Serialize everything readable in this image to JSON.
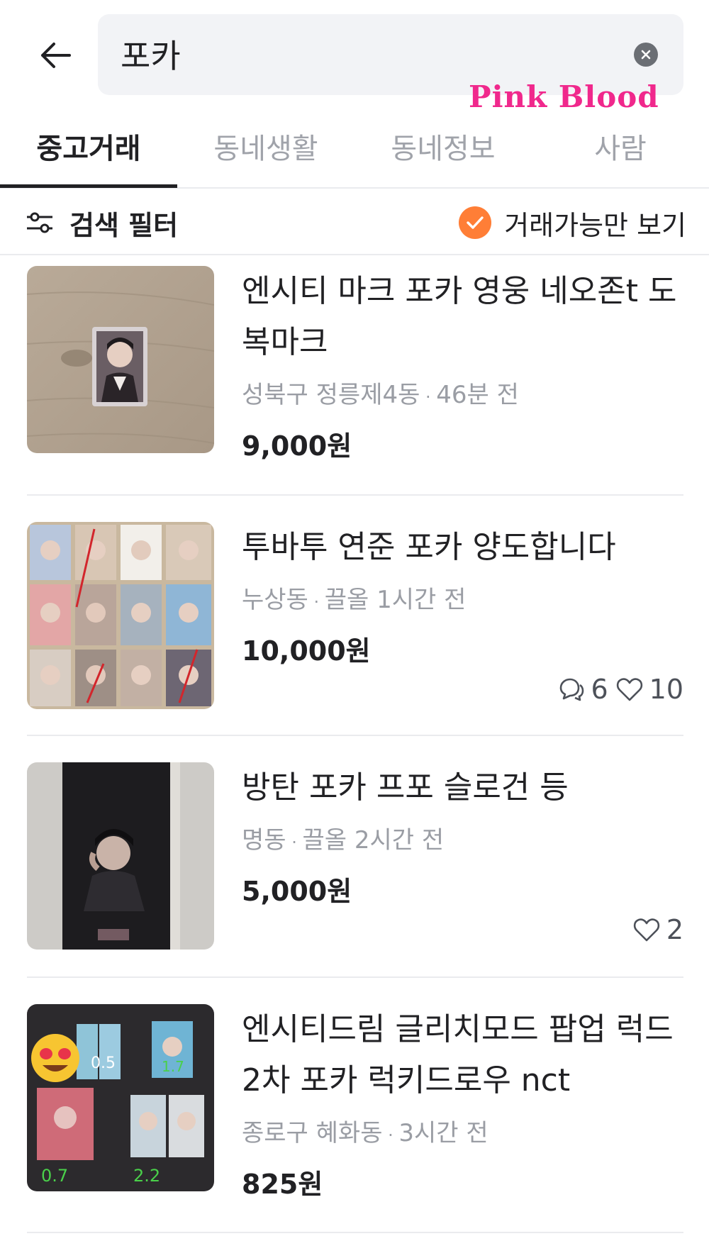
{
  "search": {
    "query": "포카"
  },
  "watermark": "Pink Blood",
  "tabs": [
    {
      "label": "중고거래",
      "active": true
    },
    {
      "label": "동네생활",
      "active": false
    },
    {
      "label": "동네정보",
      "active": false
    },
    {
      "label": "사람",
      "active": false
    }
  ],
  "filter": {
    "label": "검색 필터",
    "available_only_label": "거래가능만 보기",
    "available_only_checked": true
  },
  "colors": {
    "accent": "#ff7e36",
    "watermark": "#f0288c"
  },
  "listings": [
    {
      "title": "엔시티 마크 포카 영웅 네오존t 도복마크",
      "location": "성북구 정릉제4동",
      "time": "46분 전",
      "price": "9,000원",
      "chats": null,
      "likes": null
    },
    {
      "title": "투바투 연준 포카 양도합니다",
      "location": "누상동",
      "time": "끌올 1시간 전",
      "price": "10,000원",
      "chats": "6",
      "likes": "10"
    },
    {
      "title": "방탄 포카 프포 슬로건 등",
      "location": "명동",
      "time": "끌올 2시간 전",
      "price": "5,000원",
      "chats": null,
      "likes": "2"
    },
    {
      "title": "엔시티드림 글리치모드 팝업 럭드 2차 포카 럭키드로우 nct",
      "location": "종로구 혜화동",
      "time": "3시간 전",
      "price": "825원",
      "chats": null,
      "likes": null
    }
  ]
}
